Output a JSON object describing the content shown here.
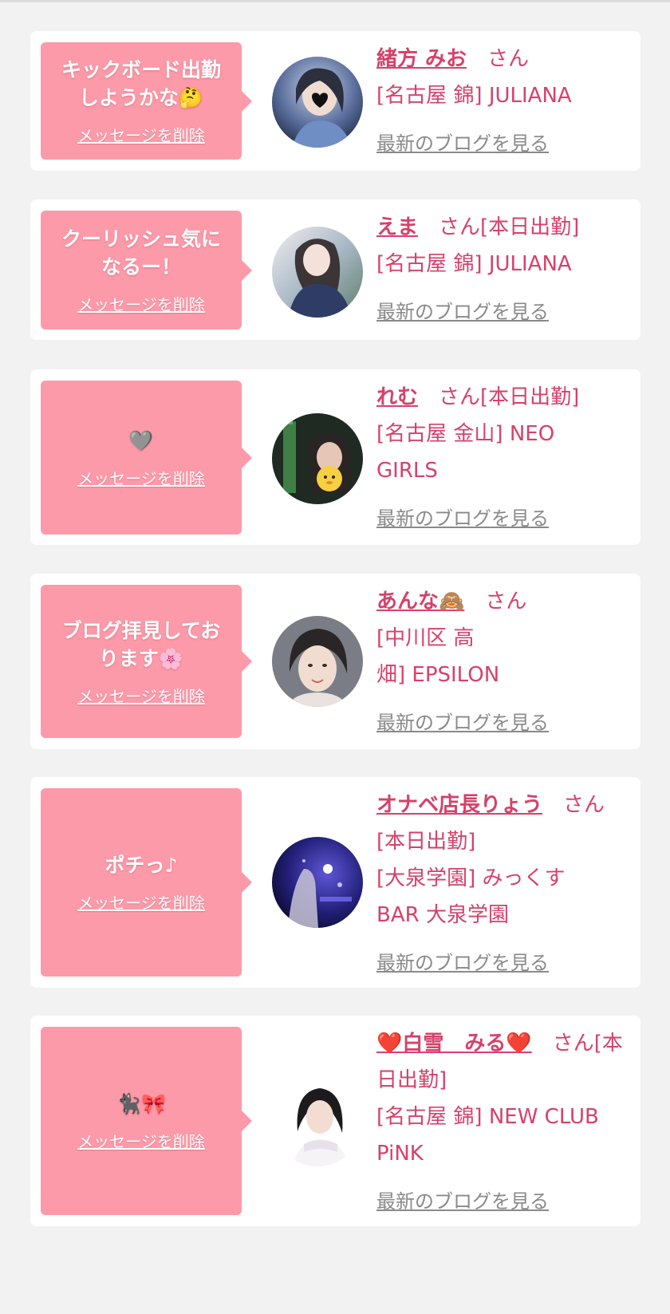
{
  "delete_label": "メッセージを削除",
  "blog_label": "最新のブログを見る",
  "honorific": "さん",
  "cards": [
    {
      "message": "キックボード出勤\nしようかな🤔",
      "name": "緒方 みお",
      "status": "",
      "shop_lines": [
        "[名古屋 錦] JULIANA"
      ]
    },
    {
      "message": "クーリッシュ気に\nなるー！",
      "name": "えま",
      "status": "[本日出勤]",
      "shop_lines": [
        "[名古屋 錦] JULIANA"
      ]
    },
    {
      "message": "🩶",
      "name": "れむ",
      "status": "[本日出勤]",
      "shop_lines": [
        "[名古屋 金山] NEO",
        "GIRLS"
      ]
    },
    {
      "message": "ブログ拝見してお\nります🌸",
      "name": "あんな🙈",
      "status": "",
      "shop_lines": [
        "[中川区 高",
        "畑] EPSILON"
      ]
    },
    {
      "message": "ポチっ♪",
      "name": "オナベ店長りょう",
      "status": "[本日出勤]",
      "shop_lines": [
        "[大泉学園] みっくす",
        "BAR 大泉学園"
      ]
    },
    {
      "message": "🐈‍⬛🎀",
      "name": "❤️白雪　みる❤️",
      "status": "[本日出勤]",
      "shop_lines": [
        "[名古屋 錦] NEW CLUB",
        "PiNK"
      ]
    }
  ]
}
